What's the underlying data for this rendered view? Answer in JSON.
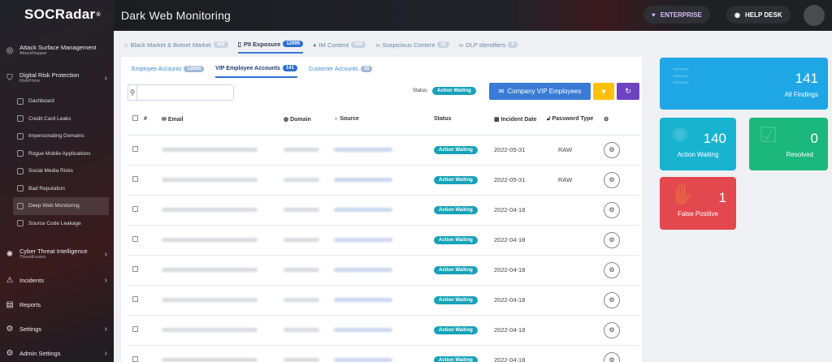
{
  "brand": {
    "logo": "SOCRadar",
    "trademark": "®"
  },
  "header": {
    "title": "Dark Web Monitoring",
    "enterprise_label": "ENTERPRISE",
    "help_label": "HELP DESK"
  },
  "sidebar": {
    "sections": [
      {
        "label": "Attack Surface Management",
        "sub": "AttackMapper",
        "icon": "globe-icon"
      },
      {
        "label": "Digital Risk Protection",
        "sub": "RiskPrime",
        "icon": "shield-icon"
      }
    ],
    "drp_items": [
      {
        "label": "Dashboard"
      },
      {
        "label": "Credit Card Leaks"
      },
      {
        "label": "Impersonating Domains"
      },
      {
        "label": "Rogue Mobile Applications"
      },
      {
        "label": "Social Media Risks"
      },
      {
        "label": "Bad Reputation"
      },
      {
        "label": "Deep Web Monitoring"
      },
      {
        "label": "Source Code Leakage"
      }
    ],
    "bottom": [
      {
        "label": "Cyber Threat Intelligence",
        "sub": "ThreatFusion",
        "icon": "brain-icon"
      },
      {
        "label": "Incidents",
        "sub": "",
        "icon": "alert-icon"
      },
      {
        "label": "Reports",
        "sub": "",
        "icon": "report-icon"
      },
      {
        "label": "Settings",
        "sub": "",
        "icon": "gear-icon"
      },
      {
        "label": "Admin Settings",
        "sub": "",
        "icon": "user-gear-icon"
      }
    ]
  },
  "main_tabs": [
    {
      "label": "Black Market & Botnet Market",
      "count": "452",
      "icon": "tag-icon"
    },
    {
      "label": "PII Exposure",
      "count": "12999",
      "icon": "file-icon"
    },
    {
      "label": "IM Content",
      "count": "555",
      "icon": "chat-icon"
    },
    {
      "label": "Suspicious Content",
      "count": "22",
      "icon": "link-icon"
    },
    {
      "label": "DLP Identifiers",
      "count": "0",
      "icon": "link-icon"
    }
  ],
  "sub_tabs": [
    {
      "label": "Employee Accounts",
      "count": "12858"
    },
    {
      "label": "VIP Employee Accounts",
      "count": "141"
    },
    {
      "label": "Customer Accounts",
      "count": "18"
    }
  ],
  "toolbar": {
    "search_placeholder": "",
    "status_label": "Status:",
    "status_value": "Action Waiting",
    "vip_button": "Company VIP Employees"
  },
  "table": {
    "headers": {
      "num": "#",
      "email": "Email",
      "domain": "Domain",
      "source": "Source",
      "status": "Status",
      "date": "Incident Date",
      "pwtype": "Password Type"
    },
    "rows": [
      {
        "status": "Action Waiting",
        "date": "2022-05-31",
        "pwtype": "RAW"
      },
      {
        "status": "Action Waiting",
        "date": "2022-05-31",
        "pwtype": "RAW"
      },
      {
        "status": "Action Waiting",
        "date": "2022-04-18",
        "pwtype": ""
      },
      {
        "status": "Action Waiting",
        "date": "2022-04-18",
        "pwtype": ""
      },
      {
        "status": "Action Waiting",
        "date": "2022-04-18",
        "pwtype": ""
      },
      {
        "status": "Action Waiting",
        "date": "2022-04-18",
        "pwtype": ""
      },
      {
        "status": "Action Waiting",
        "date": "2022-04-18",
        "pwtype": ""
      },
      {
        "status": "Action Waiting",
        "date": "2022-04-18",
        "pwtype": ""
      }
    ]
  },
  "stats": {
    "all": {
      "value": "141",
      "label": "All Findings",
      "color": "#1ea7e4"
    },
    "waiting": {
      "value": "140",
      "label": "Action Waiting",
      "color": "#17b3cf"
    },
    "resolved": {
      "value": "0",
      "label": "Resolved",
      "color": "#1cb77d"
    },
    "false_positive": {
      "value": "1",
      "label": "False Positive",
      "color": "#e2484e"
    }
  }
}
